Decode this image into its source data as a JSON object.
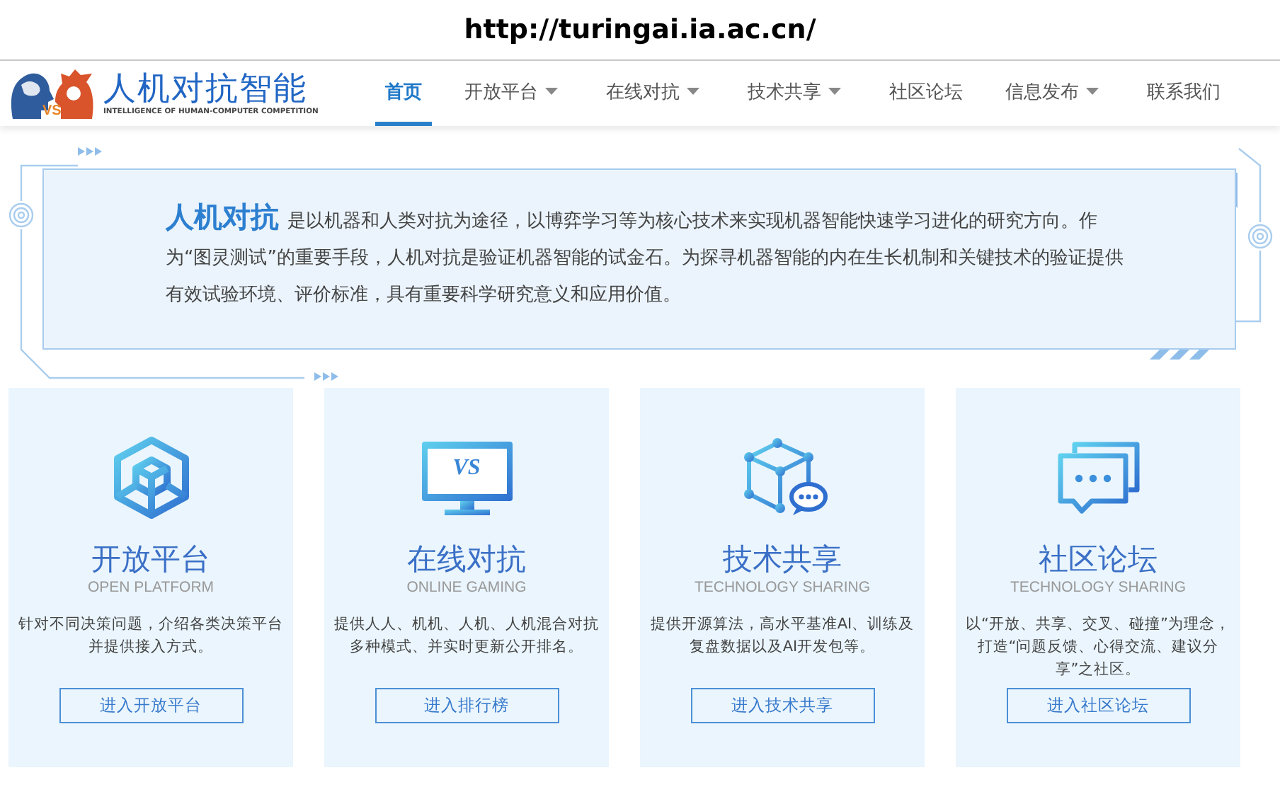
{
  "url_caption": "http://turingai.ia.ac.cn/",
  "logo": {
    "badge": "VS",
    "title": "人机对抗智能",
    "subtitle": "INTELLIGENCE OF HUMAN-COMPUTER COMPETITION"
  },
  "nav": [
    {
      "label": "首页",
      "selected": true,
      "dropdown": false
    },
    {
      "label": "开放平台",
      "selected": false,
      "dropdown": true
    },
    {
      "label": "在线对抗",
      "selected": false,
      "dropdown": true
    },
    {
      "label": "技术共享",
      "selected": false,
      "dropdown": true
    },
    {
      "label": "社区论坛",
      "selected": false,
      "dropdown": false
    },
    {
      "label": "信息发布",
      "selected": false,
      "dropdown": true
    },
    {
      "label": "联系我们",
      "selected": false,
      "dropdown": false
    }
  ],
  "intro": {
    "text": "**人机对抗** 是以机器和人类对抗为途径，以博弈学习等为核心技术来实现机器智能快速学习进化的研究方向。作为“图灵测试”的重要手段，人机对抗是验证机器智能的试金石。为探寻机器智能的内在生长机制和关键技术的验证提供有效试验环境、评价标准，具有重要科学研究意义和应用价值。"
  },
  "cards": [
    {
      "kind": "cube",
      "title": "开放平台",
      "subtitle": "OPEN PLATFORM",
      "description": "针对不同决策问题，介绍各类决策平台并提供接入方式。",
      "button": "进入开放平台"
    },
    {
      "kind": "monitor",
      "screen_text": "VS",
      "title": "在线对抗",
      "subtitle": "ONLINE GAMING",
      "description": "提供人人、机机、人机、人机混合对抗多种模式、并实时更新公开排名。",
      "button": "进入排行榜"
    },
    {
      "kind": "network",
      "title": "技术共享",
      "subtitle": "TECHNOLOGY SHARING",
      "description": "提供开源算法，高水平基准AI、训练及复盘数据以及AI开发包等。",
      "button": "进入技术共享"
    },
    {
      "kind": "chat",
      "title": "社区论坛",
      "subtitle": "TECHNOLOGY SHARING",
      "description": "以“开放、共享、交叉、碰撞”为理念，打造“问题反馈、心得交流、建议分享”之社区。",
      "button": "进入社区论坛"
    }
  ]
}
